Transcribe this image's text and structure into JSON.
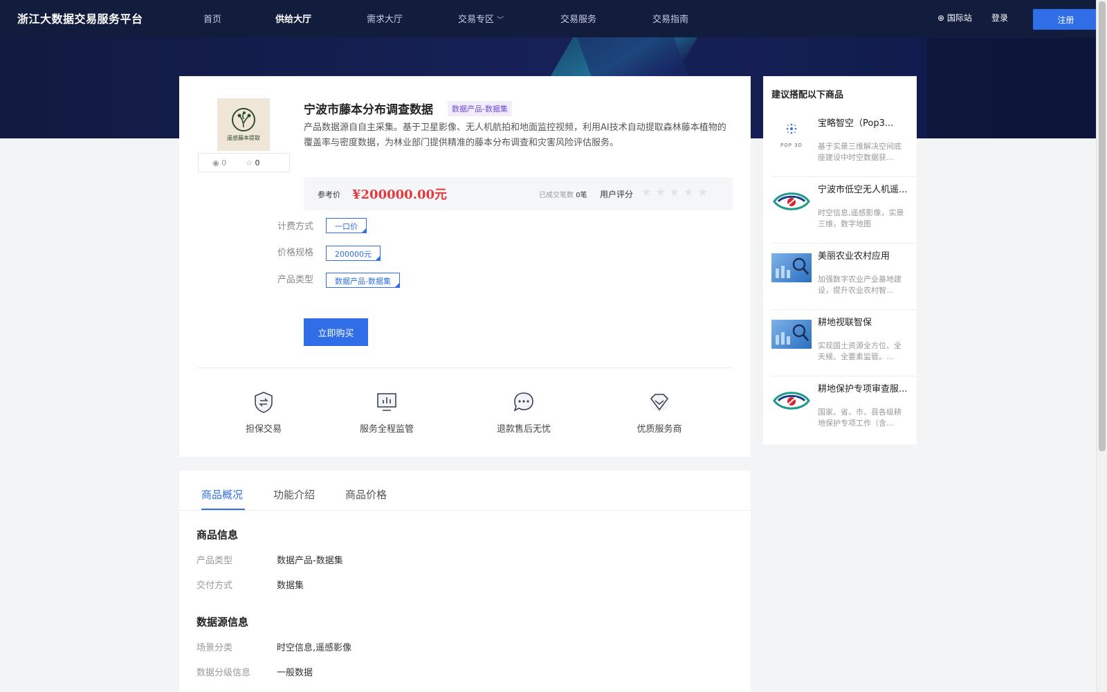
{
  "nav": {
    "logo": "浙江大数据交易服务平台",
    "items": [
      "首页",
      "供给大厅",
      "需求大厅",
      "交易专区",
      "交易服务",
      "交易指南"
    ],
    "international": "国际站",
    "login": "登录",
    "register": "注册"
  },
  "product": {
    "image_caption": "遥感藤本提取",
    "views": "0",
    "favorites": "0",
    "title": "宁波市藤本分布调查数据",
    "tag": "数据产品-数据集",
    "description": "产品数据源自自主采集。基于卫星影像、无人机航拍和地面监控视频，利用AI技术自动提取森林藤本植物的覆盖率与密度数据，为林业部门提供精准的藤本分布调查和灾害风险评估服务。",
    "price_label": "参考价",
    "price": "¥200000.00元",
    "deals_label": "已成交笔数",
    "deals_value": "0笔",
    "rating_label": "用户评分",
    "rating": 0,
    "options": [
      {
        "label": "计费方式",
        "value": "一口价"
      },
      {
        "label": "价格规格",
        "value": "200000元"
      },
      {
        "label": "产品类型",
        "value": "数据产品-数据集"
      }
    ],
    "buy_label": "立即购买",
    "features": [
      "担保交易",
      "服务全程监管",
      "退款售后无忧",
      "优质服务商"
    ]
  },
  "recommend": {
    "title": "建议搭配以下商品",
    "items": [
      {
        "name": "宝略智空（Pop3...",
        "desc": "基于实景三维解决空间底座建设中时空数据获...",
        "img_text": "POP 3D"
      },
      {
        "name": "宁波市低空无人机遥...",
        "desc": "时空信息,遥感影像，实景三维，数字地图",
        "img_text": ""
      },
      {
        "name": "美丽农业农村应用",
        "desc": "加强数字农业产业基地建设，提升农业农村智...",
        "img_text": ""
      },
      {
        "name": "耕地视联智保",
        "desc": "实现国土资源全方位、全天候、全要素监管。...",
        "img_text": ""
      },
      {
        "name": "耕地保护专项审查服...",
        "desc": "国家、省、市、县各级耕地保护专项工作（含...",
        "img_text": ""
      }
    ]
  },
  "detail": {
    "tabs": [
      "商品概况",
      "功能介绍",
      "商品价格"
    ],
    "sections": [
      {
        "title": "商品信息",
        "rows": [
          {
            "k": "产品类型",
            "v": "数据产品-数据集"
          },
          {
            "k": "交付方式",
            "v": "数据集"
          }
        ]
      },
      {
        "title": "数据源信息",
        "rows": [
          {
            "k": "场景分类",
            "v": "时空信息,遥感影像"
          },
          {
            "k": "数据分级信息",
            "v": "一般数据"
          }
        ]
      }
    ]
  },
  "colors": {
    "accent": "#2f6ee6",
    "price": "#e4393c",
    "nav_bg": "#121c3c"
  }
}
